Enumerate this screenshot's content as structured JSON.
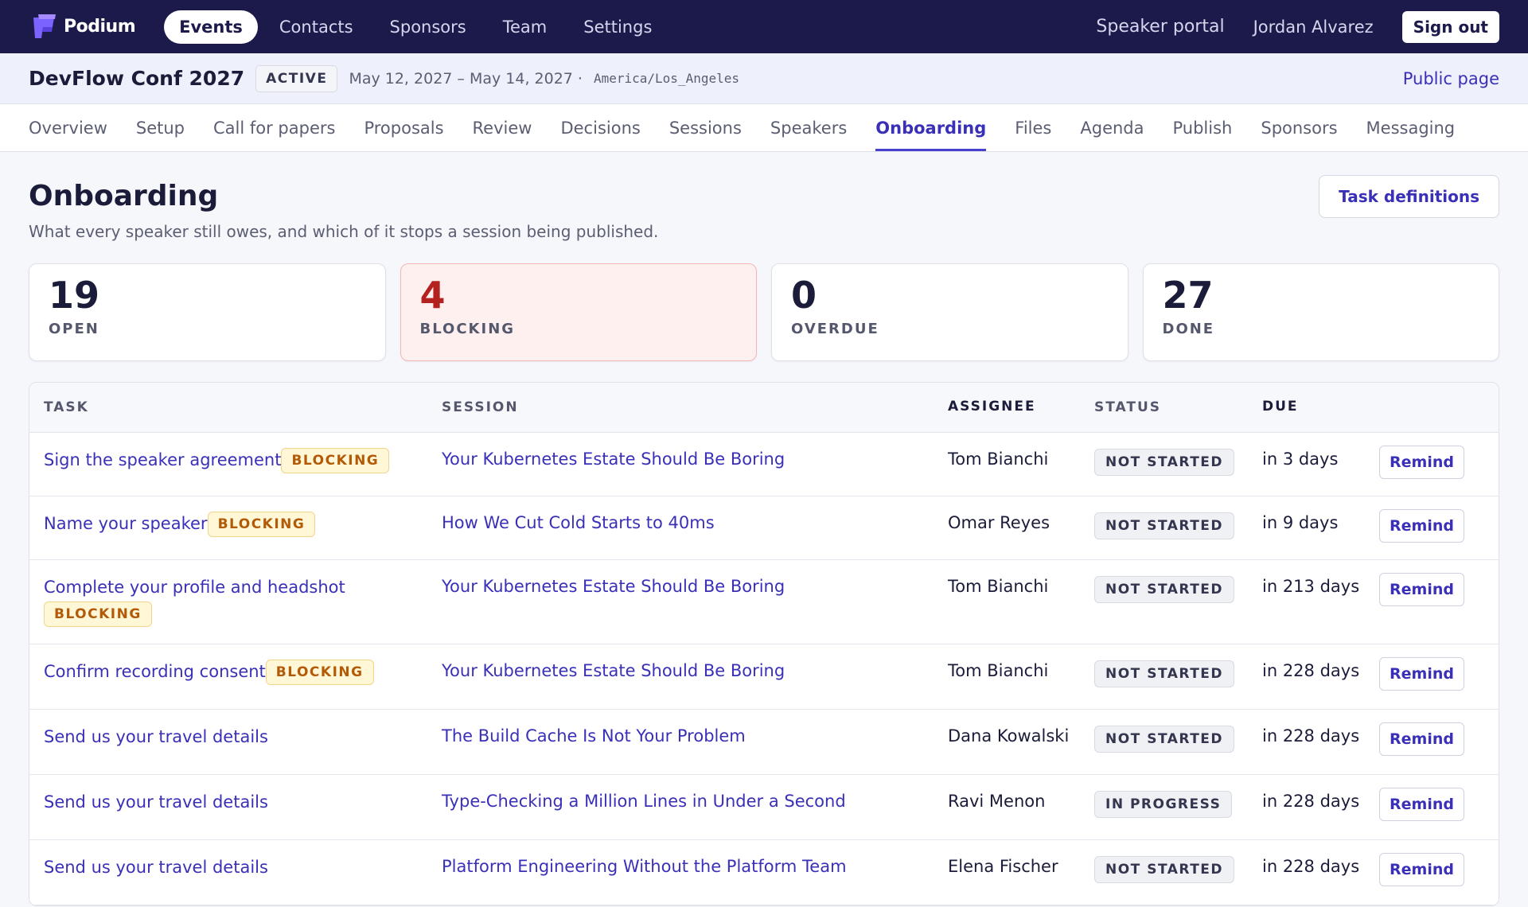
{
  "topbar": {
    "brand": "Podium",
    "nav": [
      "Events",
      "Contacts",
      "Sponsors",
      "Team",
      "Settings"
    ],
    "active_nav": 0,
    "speaker_portal": "Speaker portal",
    "user": "Jordan Alvarez",
    "sign_out": "Sign out"
  },
  "event": {
    "title": "DevFlow Conf 2027",
    "status": "ACTIVE",
    "dates": "May 12, 2027 – May 14, 2027 ·",
    "timezone": "America/Los_Angeles",
    "public_link": "Public page"
  },
  "tabs": [
    "Overview",
    "Setup",
    "Call for papers",
    "Proposals",
    "Review",
    "Decisions",
    "Sessions",
    "Speakers",
    "Onboarding",
    "Files",
    "Agenda",
    "Publish",
    "Sponsors",
    "Messaging"
  ],
  "active_tab": 8,
  "page": {
    "title": "Onboarding",
    "subtitle": "What every speaker still owes, and which of it stops a session being published.",
    "task_definitions": "Task definitions"
  },
  "stats": [
    {
      "value": "19",
      "label": "OPEN"
    },
    {
      "value": "4",
      "label": "BLOCKING"
    },
    {
      "value": "0",
      "label": "OVERDUE"
    },
    {
      "value": "27",
      "label": "DONE"
    }
  ],
  "table": {
    "headers": {
      "task": "TASK",
      "session": "SESSION",
      "assignee": "ASSIGNEE",
      "status": "STATUS",
      "due": "DUE"
    },
    "blocking_label": "BLOCKING",
    "remind_label": "Remind",
    "rows": [
      {
        "task": "Sign the speaker agreement",
        "blocking": true,
        "session": "Your Kubernetes Estate Should Be Boring",
        "assignee": "Tom Bianchi",
        "status": "NOT STARTED",
        "due": "in 3 days"
      },
      {
        "task": "Name your speaker",
        "blocking": true,
        "session": "How We Cut Cold Starts to 40ms",
        "assignee": "Omar Reyes",
        "status": "NOT STARTED",
        "due": "in 9 days"
      },
      {
        "task": "Complete your profile and headshot",
        "blocking": true,
        "session": "Your Kubernetes Estate Should Be Boring",
        "assignee": "Tom Bianchi",
        "status": "NOT STARTED",
        "due": "in 213 days"
      },
      {
        "task": "Confirm recording consent",
        "blocking": true,
        "session": "Your Kubernetes Estate Should Be Boring",
        "assignee": "Tom Bianchi",
        "status": "NOT STARTED",
        "due": "in 228 days"
      },
      {
        "task": "Send us your travel details",
        "blocking": false,
        "session": "The Build Cache Is Not Your Problem",
        "assignee": "Dana Kowalski",
        "status": "NOT STARTED",
        "due": "in 228 days"
      },
      {
        "task": "Send us your travel details",
        "blocking": false,
        "session": "Type-Checking a Million Lines in Under a Second",
        "assignee": "Ravi Menon",
        "status": "IN PROGRESS",
        "due": "in 228 days"
      },
      {
        "task": "Send us your travel details",
        "blocking": false,
        "session": "Platform Engineering Without the Platform Team",
        "assignee": "Elena Fischer",
        "status": "NOT STARTED",
        "due": "in 228 days"
      }
    ]
  }
}
